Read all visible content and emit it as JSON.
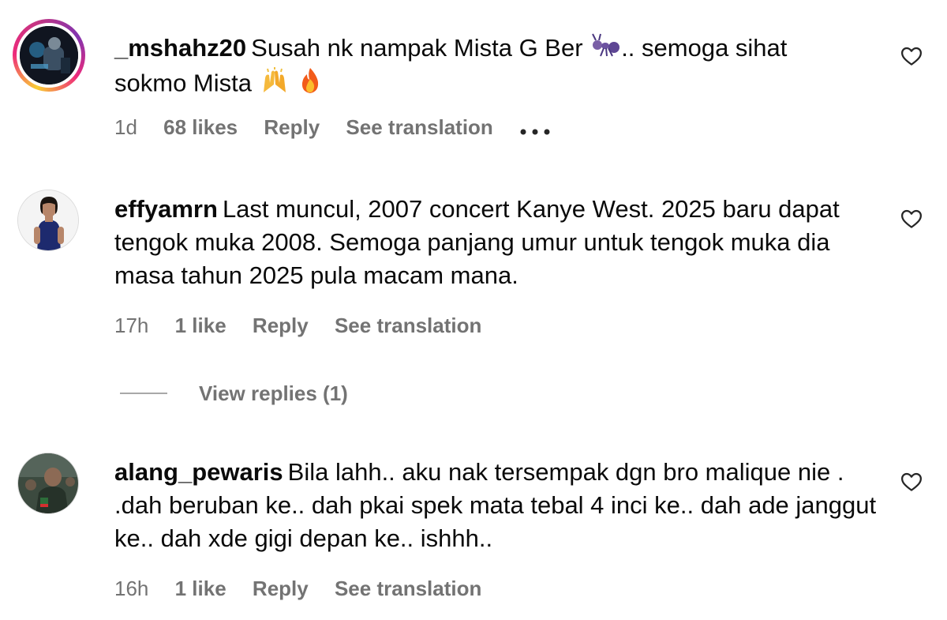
{
  "comments": [
    {
      "username": "_mshahz20",
      "text_line1": "Susah nk nampak Mista G Ber",
      "emoji_1": "ant-emoji",
      "text_line1b": ".. semoga sihat",
      "text_line2": "sokmo Mista",
      "emoji_2": "raising-hands-emoji",
      "emoji_3": "fire-emoji",
      "time": "1d",
      "likes": "68 likes",
      "reply": "Reply",
      "translate": "See translation",
      "more": "•••",
      "has_story_ring": true,
      "avatar_icon": "photo-avatar"
    },
    {
      "username": "effyamrn",
      "text": "Last muncul, 2007 concert Kanye West. 2025 baru dapat tengok muka 2008. Semoga panjang umur untuk tengok muka dia masa tahun 2025 pula macam mana.",
      "time": "17h",
      "likes": "1 like",
      "reply": "Reply",
      "translate": "See translation",
      "avatar_icon": "person-avatar"
    },
    {
      "username": "alang_pewaris",
      "text": "Bila lahh.. aku nak tersempak dgn bro malique nie . .dah beruban ke.. dah pkai spek mata tebal 4 inci ke.. dah ade janggut ke.. dah xde gigi depan ke.. ishhh..",
      "time": "16h",
      "likes": "1 like",
      "reply": "Reply",
      "translate": "See translation",
      "avatar_icon": "photo-avatar"
    }
  ],
  "view_replies": "View replies (1)",
  "colors": {
    "text": "#0a0a0a",
    "meta": "#737373",
    "divider": "#a8a8a8",
    "story_ring": [
      "#f9ce34",
      "#ee2a7b",
      "#8134af"
    ]
  }
}
